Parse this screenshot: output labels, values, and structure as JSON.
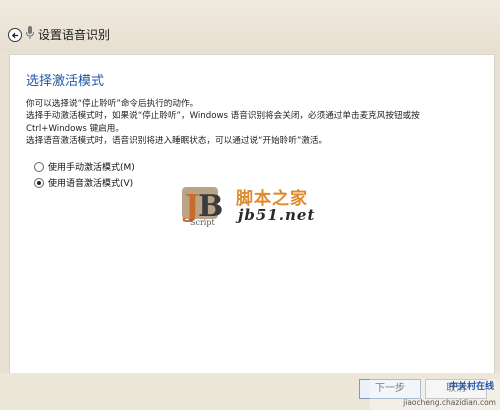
{
  "window": {
    "title": "设置语音识别",
    "back_icon": "back-arrow-icon",
    "app_icon": "microphone-icon"
  },
  "main": {
    "heading": "选择激活模式",
    "description_lines": [
      "你可以选择说“停止聆听”命令后执行的动作。",
      "选择手动激活模式时，如果说“停止聆听”，Windows 语音识别将会关闭，必须通过单击麦克风按钮或按",
      "Ctrl+Windows 键启用。",
      "选择语音激活模式时，语音识别将进入睡眠状态，可以通过说“开始聆听”激活。"
    ],
    "options": [
      {
        "label": "使用手动激活模式(M)",
        "checked": false
      },
      {
        "label": "使用语音激活模式(V)",
        "checked": true
      }
    ]
  },
  "footer": {
    "ok_label": "下一步",
    "cancel_label": "取消"
  },
  "watermark": {
    "logo_text": "JB",
    "script_text": "Script",
    "name": "脚本之家",
    "url": "jb51.net",
    "site_name": "中关村在线",
    "site_url": "jiaocheng.chazidian.com"
  },
  "colors": {
    "heading": "#1f56a8",
    "background": "#e9e2d4",
    "content_bg": "#ffffff",
    "watermark_orange": "#e08a2e"
  }
}
